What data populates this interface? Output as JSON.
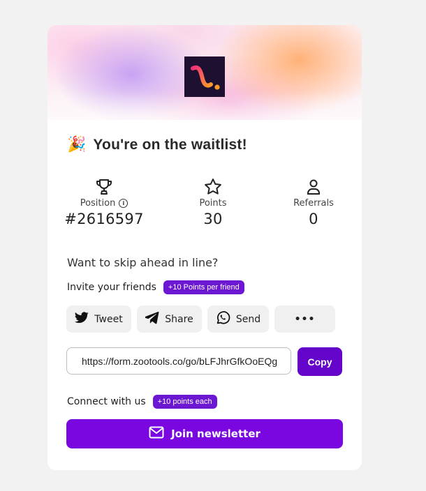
{
  "header": {
    "title_emoji": "🎉",
    "title": "You're on the waitlist!"
  },
  "stats": [
    {
      "icon": "trophy-icon",
      "label": "Position",
      "value": "#2616597"
    },
    {
      "icon": "star-icon",
      "label": "Points",
      "value": "30"
    },
    {
      "icon": "user-icon",
      "label": "Referrals",
      "value": "0"
    }
  ],
  "skip": {
    "heading": "Want to skip ahead in line?"
  },
  "invite": {
    "label": "Invite your friends",
    "badge": "+10 Points per friend",
    "buttons": [
      {
        "label": "Tweet",
        "icon": "twitter-icon"
      },
      {
        "label": "Share",
        "icon": "telegram-icon"
      },
      {
        "label": "Send",
        "icon": "whatsapp-icon"
      },
      {
        "label": "•••",
        "icon": "more-icon"
      }
    ]
  },
  "referral": {
    "url": "https://form.zootools.co/go/bLFJhrGfkOoEQg",
    "copy_label": "Copy"
  },
  "connect": {
    "label": "Connect with us",
    "badge": "+10 points each",
    "newsletter_label": "Join newsletter"
  },
  "colors": {
    "accent": "#6c17d1",
    "button_primary": "#7a06e0",
    "background": "#f2f2f2",
    "card": "#ffffff"
  }
}
